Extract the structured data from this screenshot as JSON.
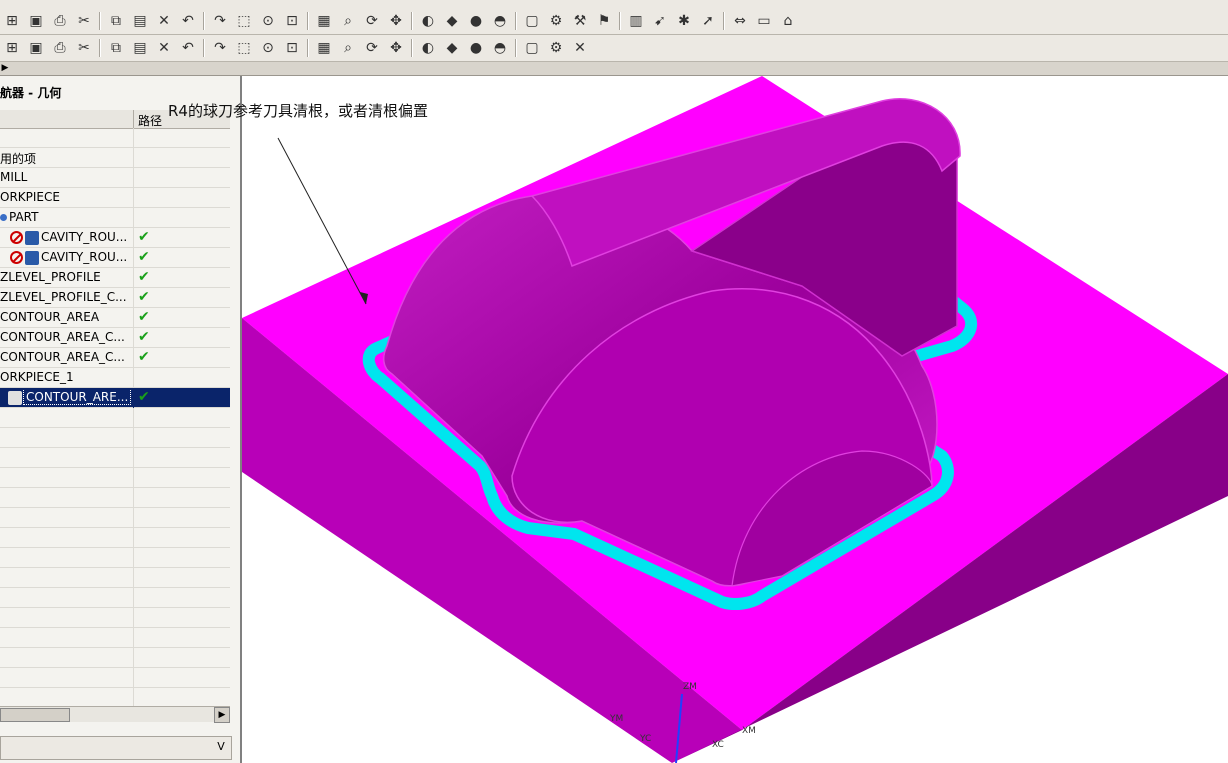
{
  "toolbars": {
    "row1": [
      "open-icon",
      "save-icon",
      "print-icon",
      "cut-icon",
      "copy-icon",
      "paste-icon",
      "delete-icon",
      "undo-icon",
      "redo-icon",
      "select-icon",
      "view-icon",
      "fit-icon",
      "frame-icon",
      "zoom-icon",
      "rotate-icon",
      "pan-icon",
      "shade-icon",
      "cube-icon",
      "sphere-icon",
      "hat-icon",
      "box-icon",
      "tool-icon",
      "tool2-icon",
      "tool3-icon",
      "chart-icon",
      "pointer-icon",
      "magic-icon",
      "arrow-icon",
      "dim-icon",
      "ruler-icon",
      "measure-icon"
    ],
    "row2": [
      "op1-icon",
      "op2-icon",
      "op3-icon",
      "op4-icon",
      "op5-icon",
      "op6-icon",
      "op7-icon",
      "op8-icon",
      "op9-icon",
      "op10-icon",
      "op11-icon",
      "op12-icon",
      "op13-icon",
      "op14-icon",
      "op15-icon",
      "op16-icon",
      "op17-icon",
      "op18-icon",
      "op19-icon",
      "op20-icon",
      "op21-icon",
      "op22-icon",
      "close-icon"
    ]
  },
  "navigator": {
    "title": "航器 - 几何",
    "column_path": "路径",
    "rows": [
      {
        "name": "",
        "icon": "none",
        "check": false
      },
      {
        "name": "用的项",
        "icon": "none",
        "check": false
      },
      {
        "name": "MILL",
        "icon": "none",
        "check": false
      },
      {
        "name": "ORKPIECE",
        "icon": "none",
        "check": false
      },
      {
        "name": "PART",
        "icon": "dot",
        "check": false
      },
      {
        "name": "CAVITY_ROU...",
        "icon": "prohibit",
        "check": true
      },
      {
        "name": "CAVITY_ROU...",
        "icon": "prohibit",
        "check": true
      },
      {
        "name": "ZLEVEL_PROFILE",
        "icon": "none",
        "check": true
      },
      {
        "name": "ZLEVEL_PROFILE_C...",
        "icon": "none",
        "check": true
      },
      {
        "name": "CONTOUR_AREA",
        "icon": "none",
        "check": true
      },
      {
        "name": "CONTOUR_AREA_C...",
        "icon": "none",
        "check": true
      },
      {
        "name": "CONTOUR_AREA_C...",
        "icon": "none",
        "check": true
      },
      {
        "name": "ORKPIECE_1",
        "icon": "none",
        "check": false
      },
      {
        "name": "CONTOUR_ARE...",
        "icon": "op",
        "check": true,
        "selected": true
      }
    ],
    "check_mark": "✔"
  },
  "viewport": {
    "annotation": "R4的球刀参考刀具清根，或者清根偏置",
    "axis_labels": [
      "ZM",
      "YM",
      "YC",
      "XM",
      "XC"
    ],
    "colors": {
      "part": "#ff00ff",
      "part_dark": "#9a009a",
      "toolpath": "#00e5ee"
    }
  }
}
